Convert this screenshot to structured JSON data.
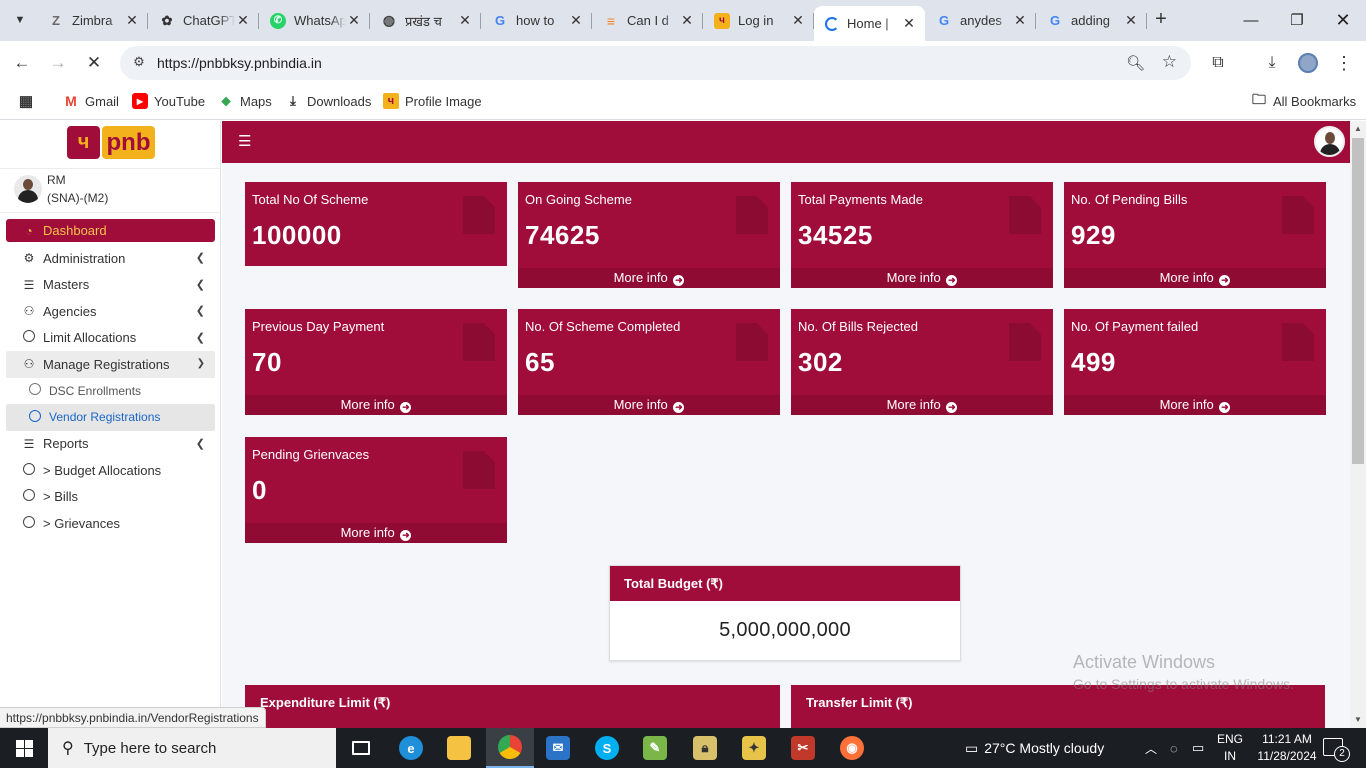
{
  "browser": {
    "tabs": [
      {
        "title": "Zimbra",
        "favicon": "zimbra-z",
        "color": "#6b6b6b"
      },
      {
        "title": "ChatGPT",
        "favicon": "chatgpt-knot",
        "color": "#333"
      },
      {
        "title": "WhatsApp",
        "favicon": "whatsapp",
        "color": "#25d366"
      },
      {
        "title": "प्रखंड च",
        "favicon": "globe",
        "color": "#444"
      },
      {
        "title": "how to",
        "favicon": "google-g",
        "color": "#4285f4"
      },
      {
        "title": "Can I d",
        "favicon": "stackoverflow",
        "color": "#f48024"
      },
      {
        "title": "Log in",
        "favicon": "pnb",
        "color": "#a10d3a"
      },
      {
        "title": "Home |",
        "favicon": "loading-spinner",
        "color": "#1a73e8",
        "active": true
      },
      {
        "title": "anydes",
        "favicon": "google-g",
        "color": "#4285f4"
      },
      {
        "title": "adding",
        "favicon": "google-g",
        "color": "#4285f4"
      }
    ],
    "url": "https://pnbbksy.pnbindia.in",
    "bookmarks": [
      {
        "label": "Gmail"
      },
      {
        "label": "YouTube"
      },
      {
        "label": "Maps"
      },
      {
        "label": "Downloads"
      },
      {
        "label": "Profile Image"
      }
    ],
    "all_bookmarks": "All Bookmarks",
    "status_url": "https://pnbbksy.pnbindia.in/VendorRegistrations"
  },
  "app": {
    "logo_text": "pnb",
    "logo_mark": "ч",
    "user": {
      "name": "RM",
      "role": "(SNA)-(M2)"
    },
    "menu": {
      "dashboard": "Dashboard",
      "administration": "Administration",
      "masters": "Masters",
      "agencies": "Agencies",
      "limit_allocations": "Limit Allocations",
      "manage_registrations": "Manage Registrations",
      "dsc_enrollments": "DSC Enrollments",
      "vendor_registrations": "Vendor Registrations",
      "reports": "Reports",
      "budget_allocations": "> Budget Allocations",
      "bills": "> Bills",
      "grievances": "> Grievances"
    },
    "more_info": "More info",
    "cards": {
      "total_scheme": {
        "label": "Total No Of Scheme",
        "value": "100000"
      },
      "ongoing_scheme": {
        "label": "On Going Scheme",
        "value": "74625"
      },
      "total_payments": {
        "label": "Total Payments Made",
        "value": "34525"
      },
      "pending_bills": {
        "label": "No. Of Pending Bills",
        "value": "929"
      },
      "previous_day_payment": {
        "label": "Previous Day Payment",
        "value": "70"
      },
      "scheme_completed": {
        "label": "No. Of Scheme Completed",
        "value": "65"
      },
      "bills_rejected": {
        "label": "No. Of Bills Rejected",
        "value": "302"
      },
      "payment_failed": {
        "label": "No. Of Payment failed",
        "value": "499"
      },
      "pending_grievances": {
        "label": "Pending Grienvaces",
        "value": "0"
      }
    },
    "total_budget": {
      "label": "Total Budget (₹)",
      "value": "5,000,000,000"
    },
    "expenditure_limit": "Expenditure Limit (₹)",
    "transfer_limit": "Transfer Limit (₹)",
    "brand_color": "#a10d3a",
    "accent_color": "#f3b21c"
  },
  "watermark": {
    "line1": "Activate Windows",
    "line2": "Go to Settings to activate Windows."
  },
  "taskbar": {
    "search_placeholder": "Type here to search",
    "weather": "27°C  Mostly cloudy",
    "lang1": "ENG",
    "lang2": "IN",
    "time": "11:21 AM",
    "date": "11/28/2024",
    "notification_count": "2"
  }
}
